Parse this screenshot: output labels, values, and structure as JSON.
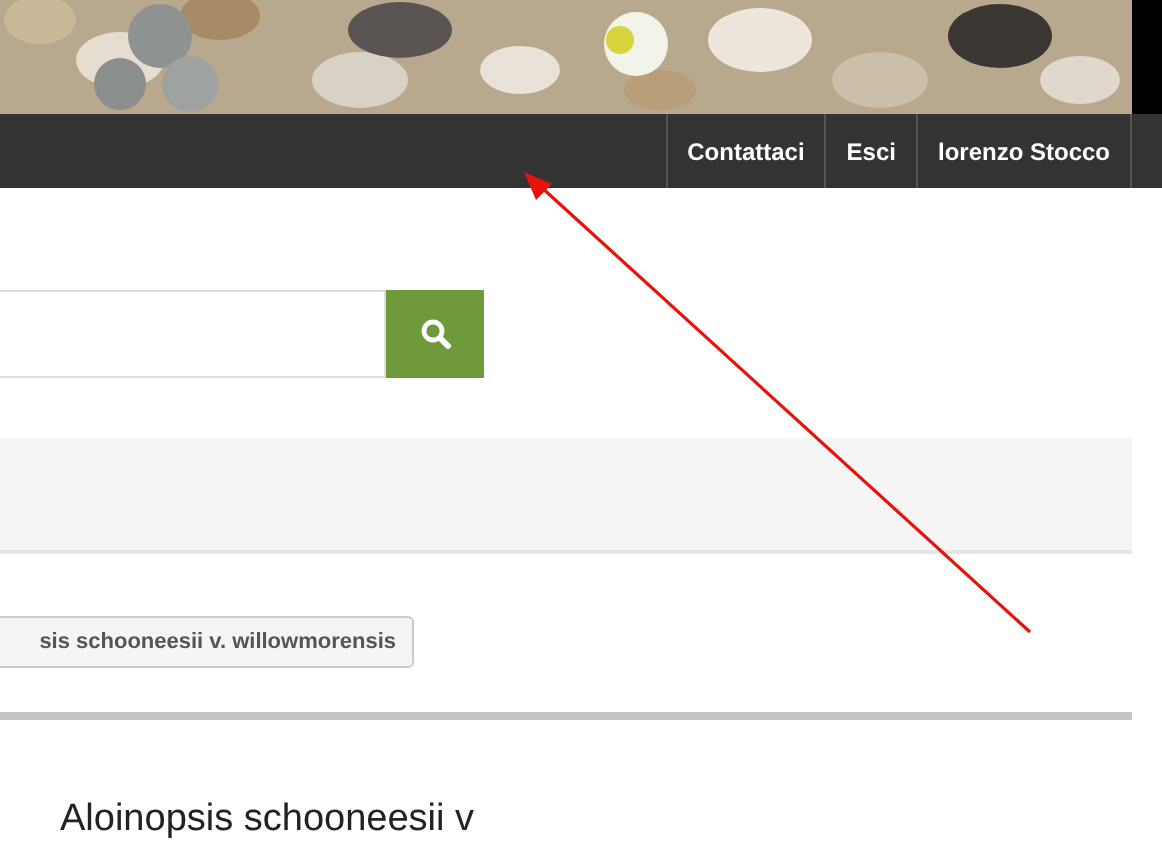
{
  "nav": {
    "items": [
      {
        "label": "Contattaci"
      },
      {
        "label": "Esci"
      },
      {
        "label": "lorenzo Stocco"
      }
    ]
  },
  "tag": {
    "label": "sis schooneesii v. willowmorensis"
  },
  "heading": "Aloinopsis schooneesii v"
}
